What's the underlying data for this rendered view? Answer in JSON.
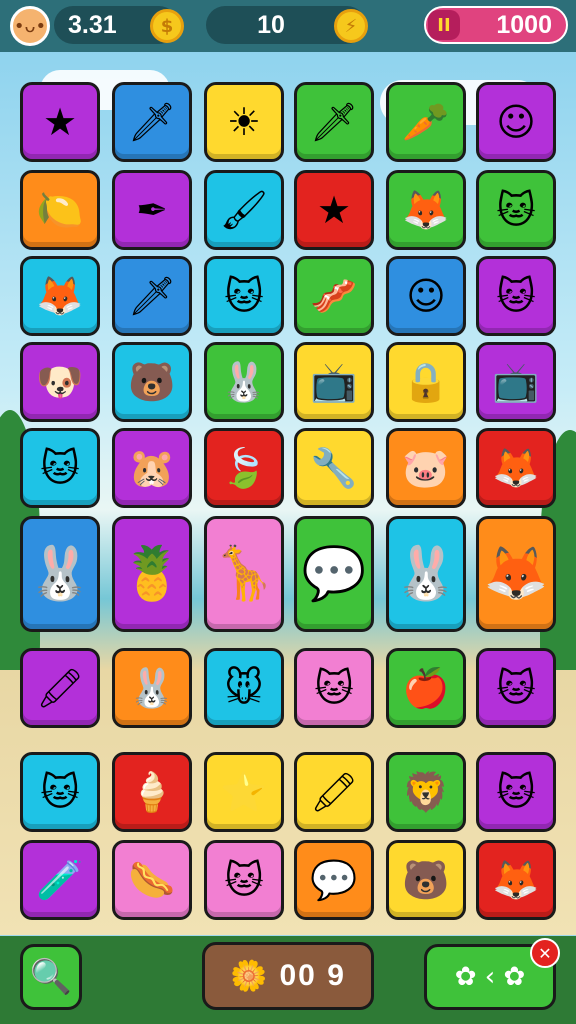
{
  "hud": {
    "timer_value": "3.31",
    "moves_value": "10",
    "coins_value": "1000",
    "pause_icon": "pause-icon",
    "coin_icon": "coin-icon",
    "level_value": "00 9"
  },
  "colors": {
    "purple": "#b330d9",
    "blue": "#2f8fe0",
    "yellow": "#ffd92e",
    "green": "#3fc23a",
    "orange": "#ff8c1a",
    "cyan": "#1ec3e6",
    "red": "#e3231f",
    "pink": "#f27fd2",
    "gold": "#ffb92e"
  },
  "tiles": [
    {
      "row": 0,
      "col": 0,
      "color": "purple",
      "glyph": "★",
      "item": "star-wand"
    },
    {
      "row": 0,
      "col": 1,
      "color": "blue",
      "glyph": "🗡",
      "item": "sword"
    },
    {
      "row": 0,
      "col": 2,
      "color": "yellow",
      "glyph": "☀",
      "item": "sun-face"
    },
    {
      "row": 0,
      "col": 3,
      "color": "green",
      "glyph": "🗡",
      "item": "star-sword"
    },
    {
      "row": 0,
      "col": 4,
      "color": "green",
      "glyph": "🥕",
      "item": "leaf"
    },
    {
      "row": 0,
      "col": 5,
      "color": "purple",
      "glyph": "☺",
      "item": "smiley"
    },
    {
      "row": 1,
      "col": 0,
      "color": "orange",
      "glyph": "🍋",
      "item": "lemon"
    },
    {
      "row": 1,
      "col": 1,
      "color": "purple",
      "glyph": "✒",
      "item": "pen"
    },
    {
      "row": 1,
      "col": 2,
      "color": "cyan",
      "glyph": "🖌",
      "item": "brush"
    },
    {
      "row": 1,
      "col": 3,
      "color": "red",
      "glyph": "★",
      "item": "star"
    },
    {
      "row": 1,
      "col": 4,
      "color": "green",
      "glyph": "🦊",
      "item": "fox"
    },
    {
      "row": 1,
      "col": 5,
      "color": "green",
      "glyph": "🐱",
      "item": "cat"
    },
    {
      "row": 2,
      "col": 0,
      "color": "cyan",
      "glyph": "🦊",
      "item": "fox"
    },
    {
      "row": 2,
      "col": 1,
      "color": "blue",
      "glyph": "🗡",
      "item": "sword"
    },
    {
      "row": 2,
      "col": 2,
      "color": "cyan",
      "glyph": "🐱",
      "item": "cat"
    },
    {
      "row": 2,
      "col": 3,
      "color": "green",
      "glyph": "🥓",
      "item": "bacon"
    },
    {
      "row": 2,
      "col": 4,
      "color": "blue",
      "glyph": "☺",
      "item": "face"
    },
    {
      "row": 2,
      "col": 5,
      "color": "purple",
      "glyph": "🐱",
      "item": "cat"
    },
    {
      "row": 3,
      "col": 0,
      "color": "purple",
      "glyph": "🐶",
      "item": "dog"
    },
    {
      "row": 3,
      "col": 1,
      "color": "cyan",
      "glyph": "🐻",
      "item": "bear"
    },
    {
      "row": 3,
      "col": 2,
      "color": "green",
      "glyph": "🐰",
      "item": "bunny"
    },
    {
      "row": 3,
      "col": 3,
      "color": "yellow",
      "glyph": "📺",
      "item": "tv"
    },
    {
      "row": 3,
      "col": 4,
      "color": "yellow",
      "glyph": "🔒",
      "item": "lock"
    },
    {
      "row": 3,
      "col": 5,
      "color": "purple",
      "glyph": "📺",
      "item": "tv"
    },
    {
      "row": 4,
      "col": 0,
      "color": "cyan",
      "glyph": "🐱",
      "item": "cat"
    },
    {
      "row": 4,
      "col": 1,
      "color": "purple",
      "glyph": "🐹",
      "item": "hamster"
    },
    {
      "row": 4,
      "col": 2,
      "color": "red",
      "glyph": "🍃",
      "item": "leaf"
    },
    {
      "row": 4,
      "col": 3,
      "color": "yellow",
      "glyph": "🔧",
      "item": "tool"
    },
    {
      "row": 4,
      "col": 4,
      "color": "orange",
      "glyph": "🐷",
      "item": "pig"
    },
    {
      "row": 4,
      "col": 5,
      "color": "red",
      "glyph": "🦊",
      "item": "fox"
    },
    {
      "row": 5,
      "col": 0,
      "color": "blue",
      "glyph": "🐰",
      "item": "bunny",
      "tall": true
    },
    {
      "row": 5,
      "col": 1,
      "color": "purple",
      "glyph": "🍍",
      "item": "pineapple",
      "tall": true
    },
    {
      "row": 5,
      "col": 2,
      "color": "pink",
      "glyph": "🦒",
      "item": "giraffe",
      "tall": true
    },
    {
      "row": 5,
      "col": 3,
      "color": "green",
      "glyph": "💬",
      "item": "bubble",
      "tall": true
    },
    {
      "row": 5,
      "col": 4,
      "color": "cyan",
      "glyph": "🐰",
      "item": "bunny",
      "tall": true
    },
    {
      "row": 5,
      "col": 5,
      "color": "orange",
      "glyph": "🦊",
      "item": "fox",
      "tall": true
    },
    {
      "row": 6,
      "col": 0,
      "color": "purple",
      "glyph": "🖍",
      "item": "crayon"
    },
    {
      "row": 6,
      "col": 1,
      "color": "orange",
      "glyph": "🐰",
      "item": "bunny"
    },
    {
      "row": 6,
      "col": 2,
      "color": "cyan",
      "glyph": "🐭",
      "item": "mouse"
    },
    {
      "row": 6,
      "col": 3,
      "color": "pink",
      "glyph": "🐱",
      "item": "cat"
    },
    {
      "row": 6,
      "col": 4,
      "color": "green",
      "glyph": "🍎",
      "item": "apple"
    },
    {
      "row": 6,
      "col": 5,
      "color": "purple",
      "glyph": "🐱",
      "item": "cat"
    },
    {
      "row": 7,
      "col": 0,
      "color": "cyan",
      "glyph": "🐱",
      "item": "cat"
    },
    {
      "row": 7,
      "col": 1,
      "color": "red",
      "glyph": "🍦",
      "item": "cone"
    },
    {
      "row": 7,
      "col": 2,
      "color": "yellow",
      "glyph": "⭐",
      "item": "star-face"
    },
    {
      "row": 7,
      "col": 3,
      "color": "yellow",
      "glyph": "🖍",
      "item": "pencil"
    },
    {
      "row": 7,
      "col": 4,
      "color": "green",
      "glyph": "🦁",
      "item": "lion"
    },
    {
      "row": 7,
      "col": 5,
      "color": "purple",
      "glyph": "🐱",
      "item": "cat"
    },
    {
      "row": 8,
      "col": 0,
      "color": "purple",
      "glyph": "🧪",
      "item": "potion"
    },
    {
      "row": 8,
      "col": 1,
      "color": "pink",
      "glyph": "🌭",
      "item": "hotdog"
    },
    {
      "row": 8,
      "col": 2,
      "color": "pink",
      "glyph": "🐱",
      "item": "cat"
    },
    {
      "row": 8,
      "col": 3,
      "color": "orange",
      "glyph": "💬",
      "item": "bubble"
    },
    {
      "row": 8,
      "col": 4,
      "color": "yellow",
      "glyph": "🐻",
      "item": "bear"
    },
    {
      "row": 8,
      "col": 5,
      "color": "red",
      "glyph": "🦊",
      "item": "fox"
    }
  ],
  "bottom": {
    "search_icon": "magnifier-icon",
    "hint_icon": "sun-icon",
    "swap_icon": "swap-icon",
    "close_icon": "close-icon"
  }
}
